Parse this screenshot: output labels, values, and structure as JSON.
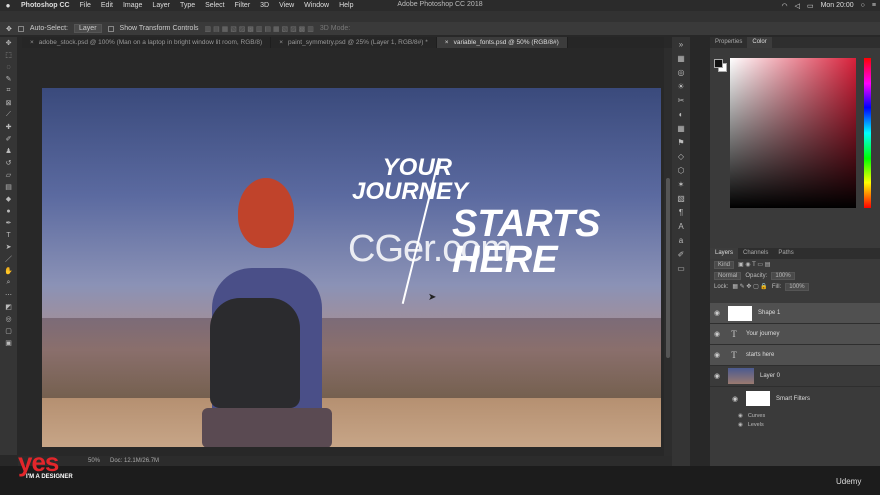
{
  "menubar": {
    "app": "Photoshop CC",
    "items": [
      "File",
      "Edit",
      "Image",
      "Layer",
      "Type",
      "Select",
      "Filter",
      "3D",
      "View",
      "Window",
      "Help"
    ],
    "window_title": "Adobe Photoshop CC 2018",
    "clock": "Mon 20:00"
  },
  "options": {
    "auto_select": "Auto-Select:",
    "auto_select_value": "Layer",
    "transform": "Show Transform Controls",
    "mode_3d": "3D Mode:"
  },
  "tabs": [
    {
      "label": "adobe_stock.psd @ 100% (Man on a laptop in bright window lit room, RGB/8)",
      "active": false
    },
    {
      "label": "paint_symmetry.psd @ 25% (Layer 1, RGB/8#) *",
      "active": false
    },
    {
      "label": "variable_fonts.psd @ 50% (RGB/8#)",
      "active": true
    }
  ],
  "canvas": {
    "text_your": "YOUR",
    "text_journey": "JOURNEY",
    "text_starts": "STARTS",
    "text_here": "HERE",
    "watermark": "CGer.com"
  },
  "status": {
    "zoom": "50%",
    "doc": "Doc: 12.1M/26.7M"
  },
  "right_panel": {
    "tabs": [
      {
        "label": "Properties",
        "active": false
      },
      {
        "label": "Color",
        "active": true
      }
    ],
    "layer_tabs": [
      {
        "label": "Layers",
        "active": true
      },
      {
        "label": "Channels",
        "active": false
      },
      {
        "label": "Paths",
        "active": false
      }
    ],
    "kind": "Kind",
    "blend": "Normal",
    "opacity_label": "Opacity:",
    "opacity": "100%",
    "lock": "Lock:",
    "fill_label": "Fill:",
    "fill": "100%",
    "layers": [
      {
        "name": "Shape 1",
        "kind": "shape",
        "selected": true
      },
      {
        "name": "Your journey",
        "kind": "text",
        "selected": true
      },
      {
        "name": "starts here",
        "kind": "text",
        "selected": true
      },
      {
        "name": "Layer 0",
        "kind": "photo",
        "selected": false
      }
    ],
    "smart_filters": "Smart Filters",
    "filters": [
      "Curves",
      "Levels"
    ]
  },
  "branding": {
    "logo": "yes",
    "logo_sub": "I'M A DESIGNER",
    "udemy": "Udemy"
  }
}
